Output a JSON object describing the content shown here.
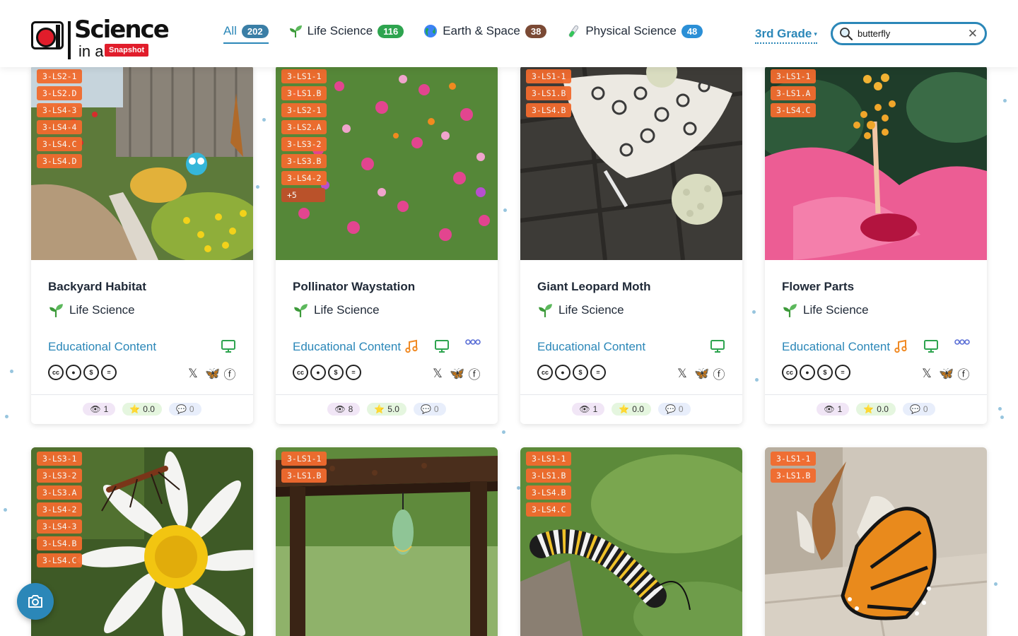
{
  "logo": {
    "title": "Science",
    "ina": "in a",
    "tag": "Snapshot"
  },
  "nav": {
    "tabs": [
      {
        "label": "All",
        "count": "202",
        "color": "#3a7ea6",
        "icon": ""
      },
      {
        "label": "Life Science",
        "count": "116",
        "color": "#2ea44f",
        "icon": "sprout-icon"
      },
      {
        "label": "Earth & Space",
        "count": "38",
        "color": "#7b4a35",
        "icon": "globe-icon"
      },
      {
        "label": "Physical Science",
        "count": "48",
        "color": "#2b8fd6",
        "icon": "test-tube-icon"
      }
    ],
    "grade": "3rd Grade"
  },
  "search": {
    "value": "butterfly",
    "placeholder": "Search"
  },
  "cards": [
    {
      "tags": [
        "3-LS2-1",
        "3-LS2.D",
        "3-LS4-3",
        "3-LS4-4",
        "3-LS4.C",
        "3-LS4.D"
      ],
      "title": "Backyard Habitat",
      "category": "Life Science",
      "edu": "Educational Content",
      "views": "1",
      "rating": "0.0",
      "comments": "0",
      "has_music": false,
      "has_more": false
    },
    {
      "tags": [
        "3-LS1-1",
        "3-LS1.B",
        "3-LS2-1",
        "3-LS2.A",
        "3-LS3-2",
        "3-LS3.B",
        "3-LS4-2"
      ],
      "more": "+5",
      "title": "Pollinator Waystation",
      "category": "Life Science",
      "edu": "Educational Content",
      "views": "8",
      "rating": "5.0",
      "comments": "0",
      "has_music": true,
      "has_more": true
    },
    {
      "tags": [
        "3-LS1-1",
        "3-LS1.B",
        "3-LS4.B"
      ],
      "title": "Giant Leopard Moth",
      "category": "Life Science",
      "edu": "Educational Content",
      "views": "1",
      "rating": "0.0",
      "comments": "0",
      "has_music": false,
      "has_more": false
    },
    {
      "tags": [
        "3-LS1-1",
        "3-LS1.A",
        "3-LS4.C"
      ],
      "title": "Flower Parts",
      "category": "Life Science",
      "edu": "Educational Content",
      "views": "1",
      "rating": "0.0",
      "comments": "0",
      "has_music": true,
      "has_more": true
    },
    {
      "tags": [
        "3-LS3-1",
        "3-LS3-2",
        "3-LS3.A",
        "3-LS4-2",
        "3-LS4-3",
        "3-LS4.B",
        "3-LS4.C"
      ]
    },
    {
      "tags": [
        "3-LS1-1",
        "3-LS1.B"
      ]
    },
    {
      "tags": [
        "3-LS1-1",
        "3-LS1.B",
        "3-LS4.B",
        "3-LS4.C"
      ]
    },
    {
      "tags": [
        "3-LS1-1",
        "3-LS1.B"
      ]
    }
  ],
  "license": [
    "cc",
    "by",
    "nc",
    "nd"
  ],
  "icon_colors": {
    "accent": "#2b87b8",
    "music": "#f08a24",
    "monitor": "#2ea44f",
    "more": "#5b6fd6",
    "tag": "#f26b2e"
  }
}
